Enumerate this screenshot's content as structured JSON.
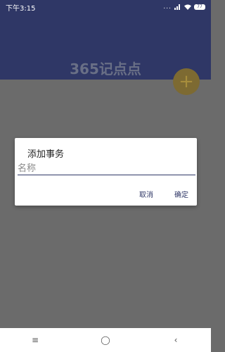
{
  "status_bar": {
    "time": "下午3:15",
    "dots": "...",
    "battery": "77"
  },
  "header": {
    "title": "365记点点"
  },
  "fab": {
    "label": "+",
    "icon": "plus-icon"
  },
  "dialog": {
    "title": "添加事务",
    "input_placeholder": "名称",
    "input_value": "",
    "cancel_label": "取消",
    "confirm_label": "确定"
  },
  "nav_bar": {
    "menu_glyph": "≡",
    "home_glyph": "◯",
    "back_glyph": "‹"
  },
  "colors": {
    "primary": "#2f3766",
    "accent": "#7d6a32",
    "scrim": "#6b6b6b"
  }
}
